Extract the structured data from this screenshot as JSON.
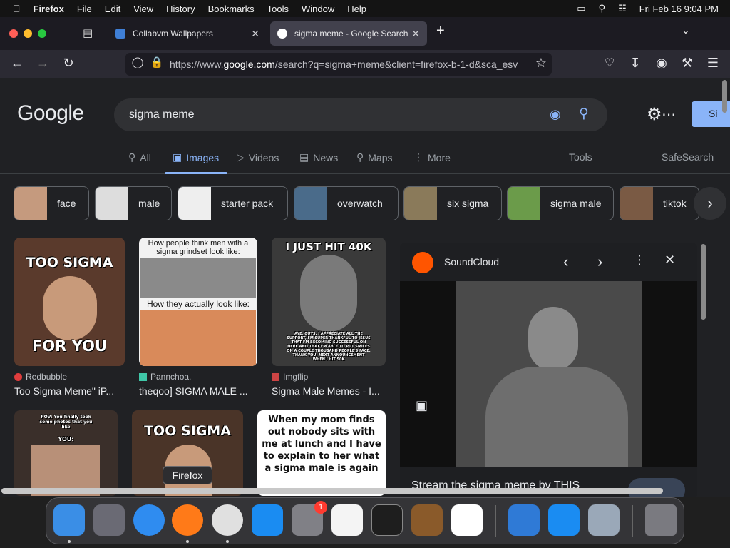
{
  "menubar": {
    "app": "Firefox",
    "items": [
      "File",
      "Edit",
      "View",
      "History",
      "Bookmarks",
      "Tools",
      "Window",
      "Help"
    ],
    "datetime": "Fri Feb 16  9:04 PM"
  },
  "tabs": [
    {
      "title": "Collabvm Wallpapers"
    },
    {
      "title": "sigma meme - Google Search"
    }
  ],
  "url": {
    "prefix": "https://www.",
    "host": "google.com",
    "path": "/search?q=sigma+meme&client=firefox-b-1-d&sca_esv"
  },
  "google": {
    "logo": "Google",
    "query": "sigma meme",
    "signin": "Si",
    "tabs": [
      "All",
      "Images",
      "Videos",
      "News",
      "Maps",
      "More"
    ],
    "tools": "Tools",
    "safesearch": "SafeSearch"
  },
  "chips": [
    "face",
    "male",
    "starter pack",
    "overwatch",
    "six sigma",
    "sigma male",
    "tiktok"
  ],
  "results": [
    {
      "source": "Redbubble",
      "title": "Too Sigma Meme\" iP...",
      "top": "TOO SIGMA",
      "bottom": "FOR YOU"
    },
    {
      "source": "Pannchoa.",
      "title": "theqoo] SIGMA MALE ...",
      "top": "How people think men with a sigma grindset look like:",
      "bottom": "How they actually look like:"
    },
    {
      "source": "Imgflip",
      "title": "Sigma Male Memes - I...",
      "top": "I JUST HIT 40K",
      "bottom": "AYE, GUYS. I APPRECIATE ALL THE SUPPORT, I'M SUPER THANKFUL TO JESUS THAT I'M BECOMING SUCCESSFUL ON HERE AND THAT I'M ABLE TO PUT SMILES ON A COUPLE THOUSAND PEOPLE'S FACE. THANK YOU, NEXT ANNOUNCEMENT WHEN I HIT 50K"
    },
    {
      "top": "POV: You finally took some photos that you like",
      "bottom": "YOU:"
    },
    {
      "top": "TOO SIGMA"
    },
    {
      "top": "When my mom finds out nobody sits with me at lunch and I have to explain to her what a sigma male is again"
    }
  ],
  "panel": {
    "source": "SoundCloud",
    "caption": "Stream the sigma meme by THIS"
  },
  "dock": {
    "tooltip": "Firefox",
    "badge": "1"
  },
  "colors": {
    "accent": "#8ab4f8",
    "page_bg": "#202124"
  }
}
